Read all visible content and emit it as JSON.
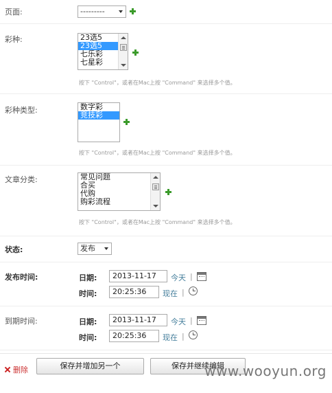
{
  "page_field": {
    "label": "页面:",
    "select_value": "---------"
  },
  "lottery_type": {
    "label": "彩种:",
    "options": [
      "23选5",
      "23选5",
      "七乐彩",
      "七星彩"
    ],
    "selected_index": 1,
    "help": "按下 \"Control\"，或者在Mac上按 \"Command\" 来选择多个值。"
  },
  "lottery_category": {
    "label": "彩种类型:",
    "options": [
      "数字彩",
      "竞技彩"
    ],
    "selected_index": 1,
    "help": "按下 \"Control\"，或者在Mac上按 \"Command\" 来选择多个值。"
  },
  "article_category": {
    "label": "文章分类:",
    "options": [
      "常见问题",
      "合买",
      "代购",
      "购彩流程"
    ],
    "help": "按下 \"Control\"，或者在Mac上按 \"Command\" 来选择多个值。"
  },
  "status": {
    "label": "状态:",
    "select_value": "发布"
  },
  "publish_time": {
    "label": "发布时间:",
    "date_label": "日期:",
    "date_value": "2013-11-17",
    "today_link": "今天",
    "time_label": "时间:",
    "time_value": "20:25:36",
    "now_link": "现在",
    "separator": "|"
  },
  "expire_time": {
    "label": "到期时间:",
    "date_label": "日期:",
    "date_value": "2013-11-17",
    "today_link": "今天",
    "time_label": "时间:",
    "time_value": "20:25:36",
    "now_link": "现在",
    "separator": "|"
  },
  "footer": {
    "delete_label": "删除",
    "save_add_another": "保存并增加另一个",
    "save_continue": "保存并继续编辑"
  },
  "watermark": "www.wooyun.org",
  "colors": {
    "link": "#447e9b",
    "delete": "#cc3333",
    "selected": "#3399ff",
    "add_icon": "#3b9b2b"
  }
}
